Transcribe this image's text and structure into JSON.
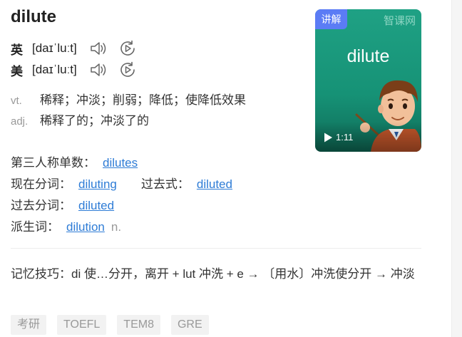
{
  "word": "dilute",
  "pronunciations": [
    {
      "lang": "英",
      "ipa": "[daɪˈluːt]",
      "speaker_icon": "speaker-icon",
      "play_icon": "replay-icon"
    },
    {
      "lang": "美",
      "ipa": "[daɪˈluːt]",
      "speaker_icon": "speaker-icon",
      "play_icon": "replay-icon"
    }
  ],
  "definitions": [
    {
      "pos": "vt.",
      "meaning": "稀释；冲淡；削弱；降低；使降低效果"
    },
    {
      "pos": "adj.",
      "meaning": "稀释了的；冲淡了的"
    }
  ],
  "forms": {
    "third_person": {
      "label": "第三人称单数：",
      "value": "dilutes"
    },
    "present_participle": {
      "label": "现在分词：",
      "value": "diluting"
    },
    "past_tense": {
      "label": "过去式：",
      "value": "diluted"
    },
    "past_participle": {
      "label": "过去分词：",
      "value": "diluted"
    },
    "derivative": {
      "label": "派生词：",
      "value": "dilution",
      "pos": "n."
    }
  },
  "memory_tip": "记忆技巧：di 使…分开，离开 + lut 冲洗 + e → 〔用水〕冲洗使分开 → 冲淡",
  "tags": [
    "考研",
    "TOEFL",
    "TEM8",
    "GRE"
  ],
  "video": {
    "badge": "讲解",
    "brand": "智课网",
    "word": "dilute",
    "duration": "1:11",
    "play_icon": "play-icon"
  },
  "colors": {
    "link": "#2e7cd6",
    "video_bg": "#169276",
    "badge_bg": "#5b7cf5",
    "tag_bg": "#f2f2f2"
  }
}
